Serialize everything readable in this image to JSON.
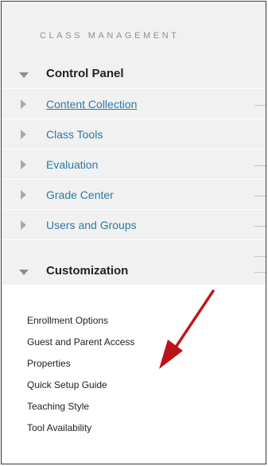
{
  "section_title": "CLASS MANAGEMENT",
  "control_panel": {
    "label": "Control Panel",
    "items": [
      {
        "label": "Content Collection"
      },
      {
        "label": "Class Tools"
      },
      {
        "label": "Evaluation"
      },
      {
        "label": "Grade Center"
      },
      {
        "label": "Users and Groups"
      }
    ]
  },
  "customization": {
    "label": "Customization",
    "items": [
      {
        "label": "Enrollment Options"
      },
      {
        "label": "Guest and Parent Access"
      },
      {
        "label": "Properties"
      },
      {
        "label": "Quick Setup Guide"
      },
      {
        "label": "Teaching Style"
      },
      {
        "label": "Tool Availability"
      }
    ]
  },
  "colors": {
    "panel_bg": "#f1f1f1",
    "link": "#2a7ba3",
    "arrow": "#c8191d"
  }
}
